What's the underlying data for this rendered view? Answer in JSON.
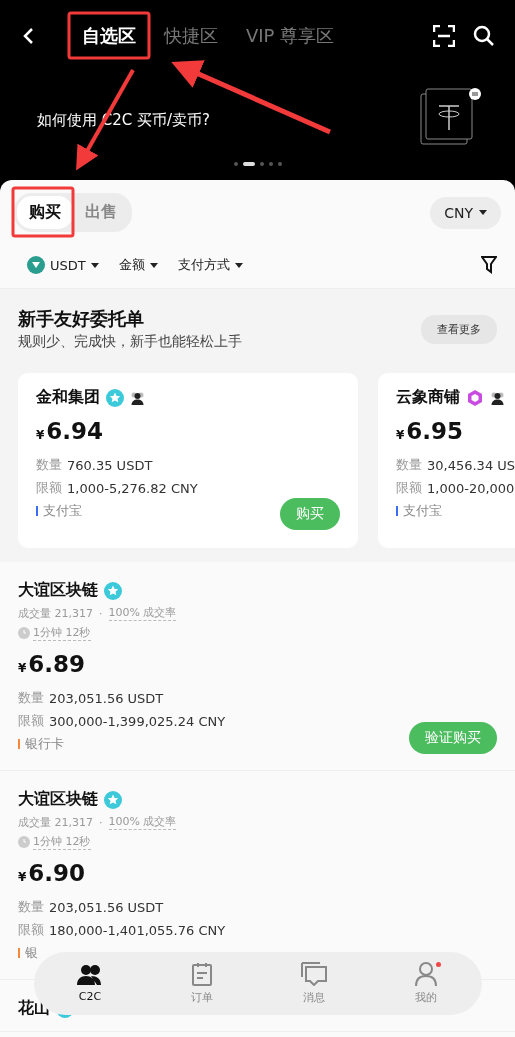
{
  "header": {
    "tabs": [
      {
        "label": "自选区",
        "selected": true
      },
      {
        "label": "快捷区",
        "selected": false
      },
      {
        "label": "VIP 尊享区",
        "selected": false
      }
    ]
  },
  "banner": {
    "text": "如何使用 C2C 买币/卖币?",
    "dots": [
      {
        "selected": false
      },
      {
        "selected": true
      },
      {
        "selected": false
      },
      {
        "selected": false
      },
      {
        "selected": false
      }
    ]
  },
  "side_toggle": [
    {
      "label": "购买",
      "selected": true
    },
    {
      "label": "出售",
      "selected": false
    }
  ],
  "currency": "CNY",
  "filters": [
    {
      "label": "USDT",
      "kind": "coin"
    },
    {
      "label": "金额",
      "kind": "plain"
    },
    {
      "label": "支付方式",
      "kind": "plain"
    }
  ],
  "featured": {
    "title": "新手友好委托单",
    "subtitle": "规则少、完成快，新手也能轻松上手",
    "more": "查看更多",
    "cards": [
      {
        "name": "金和集团",
        "kind": "star",
        "symbol": "¥",
        "price": "6.94",
        "quantity_label": "数量",
        "quantity": "760.35 USDT",
        "limit_label": "限额",
        "limit": "1,000-5,276.82 CNY",
        "payment": "支付宝",
        "color": "#3b6cf6",
        "button": "购买"
      },
      {
        "name": "云象商铺",
        "kind": "hexagon",
        "symbol": "¥",
        "price": "6.95",
        "quantity_label": "数量",
        "quantity": "30,456.34 US",
        "limit_label": "限额",
        "limit": "1,000-20,000",
        "payment": "支付宝",
        "color": "#3b6cf6"
      }
    ]
  },
  "listings": [
    {
      "name": "大谊区块链",
      "kind": "star",
      "volume": "成交量 21,317",
      "separator": "·",
      "rate": "100% 成交率",
      "time": "1分钟 12秒",
      "symbol": "¥",
      "price": "6.89",
      "quantity_label": "数量",
      "quantity": "203,051.56 USDT",
      "limit_label": "限额",
      "limit": "300,000-1,399,025.24 CNY",
      "payment": "银行卡",
      "color": "#f5883a",
      "button": "验证购买"
    },
    {
      "name": "大谊区块链",
      "kind": "star",
      "volume": "成交量 21,317",
      "separator": "·",
      "rate": "100% 成交率",
      "time": "1分钟 12秒",
      "symbol": "¥",
      "price": "6.90",
      "quantity_label": "数量",
      "quantity": "203,051.56 USDT",
      "limit_label": "限额",
      "limit": "180,000-1,401,055.76 CNY",
      "payment": "银",
      "color": "#f5883a"
    },
    {
      "name": "花山",
      "kind": "star"
    }
  ],
  "nav": [
    {
      "label": "C2C",
      "kind": "people",
      "selected": true,
      "dot": false
    },
    {
      "label": "订单",
      "kind": "orders",
      "selected": false,
      "dot": false
    },
    {
      "label": "消息",
      "kind": "messages",
      "selected": false,
      "dot": false
    },
    {
      "label": "我的",
      "kind": "profile",
      "selected": false,
      "dot": true
    }
  ]
}
